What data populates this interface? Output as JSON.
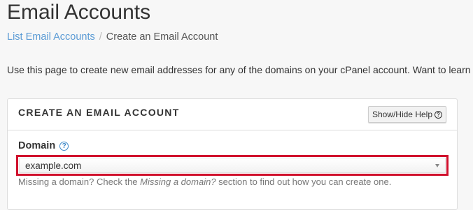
{
  "header": {
    "title": "Email Accounts"
  },
  "breadcrumb": {
    "parent": "List Email Accounts",
    "separator": "/",
    "current": "Create an Email Account"
  },
  "intro": {
    "text": "Use this page to create new email addresses for any of the domains on your cPanel account. Want to learn"
  },
  "panel": {
    "title": "CREATE AN EMAIL ACCOUNT",
    "help_toggle_label": "Show/Hide Help",
    "help_icon": "question-circle-icon"
  },
  "domain_field": {
    "label": "Domain",
    "help_icon": "question-circle-icon",
    "selected_value": "example.com",
    "highlight_color": "#d0102c",
    "help_text_prefix": "Missing a domain? Check the ",
    "help_text_emphasis": "Missing a domain?",
    "help_text_suffix": " section to find out how you can create one."
  },
  "colors": {
    "link": "#5b9bd5",
    "help_icon": "#3a87c8",
    "highlight": "#d0102c"
  }
}
